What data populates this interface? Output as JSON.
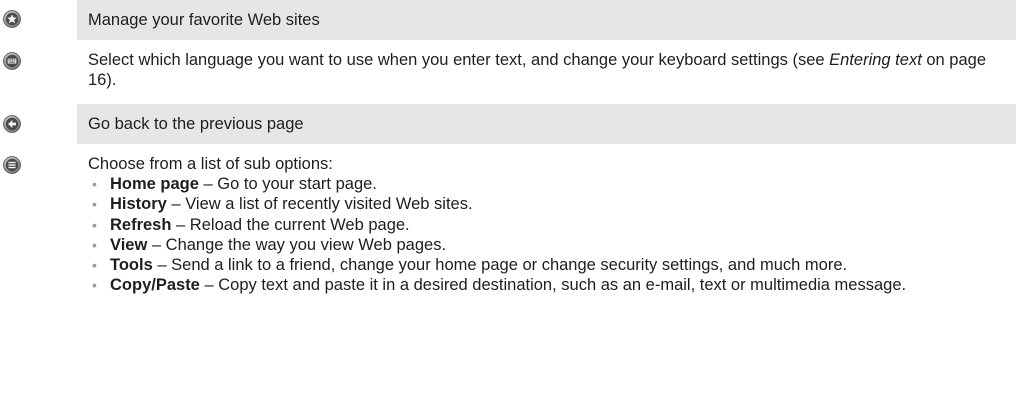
{
  "rows": {
    "favorites": {
      "icon": "star-circle-icon",
      "text": "Manage your favorite Web sites"
    },
    "language": {
      "icon": "keyboard-circle-icon",
      "text_before": "Select which language you want to use when you enter text, and change your keyboard settings (see",
      "link": "Entering text",
      "text_after": "on page 16)."
    },
    "back": {
      "icon": "back-arrow-circle-icon",
      "text": "Go back to the previous page"
    },
    "options": {
      "icon": "menu-circle-icon",
      "intro": "Choose from a list of sub options:",
      "items": [
        {
          "term": "Home page",
          "desc": "– Go to your start page."
        },
        {
          "term": "History",
          "desc": "– View a list of recently visited Web sites."
        },
        {
          "term": "Refresh",
          "desc": "– Reload the current Web page."
        },
        {
          "term": "View",
          "desc": "– Change the way you view Web pages."
        },
        {
          "term": "Tools",
          "desc": "– Send a link to a friend, change your home page or change security settings, and much more."
        },
        {
          "term": "Copy/Paste",
          "desc": "– Copy text and paste it in a desired destination, such as an e-mail, text or multimedia message."
        }
      ]
    }
  },
  "colors": {
    "row_shade": "#e6e6e6",
    "icon_fill": "#8a8a8a",
    "bullet": "#9a9a9a"
  }
}
